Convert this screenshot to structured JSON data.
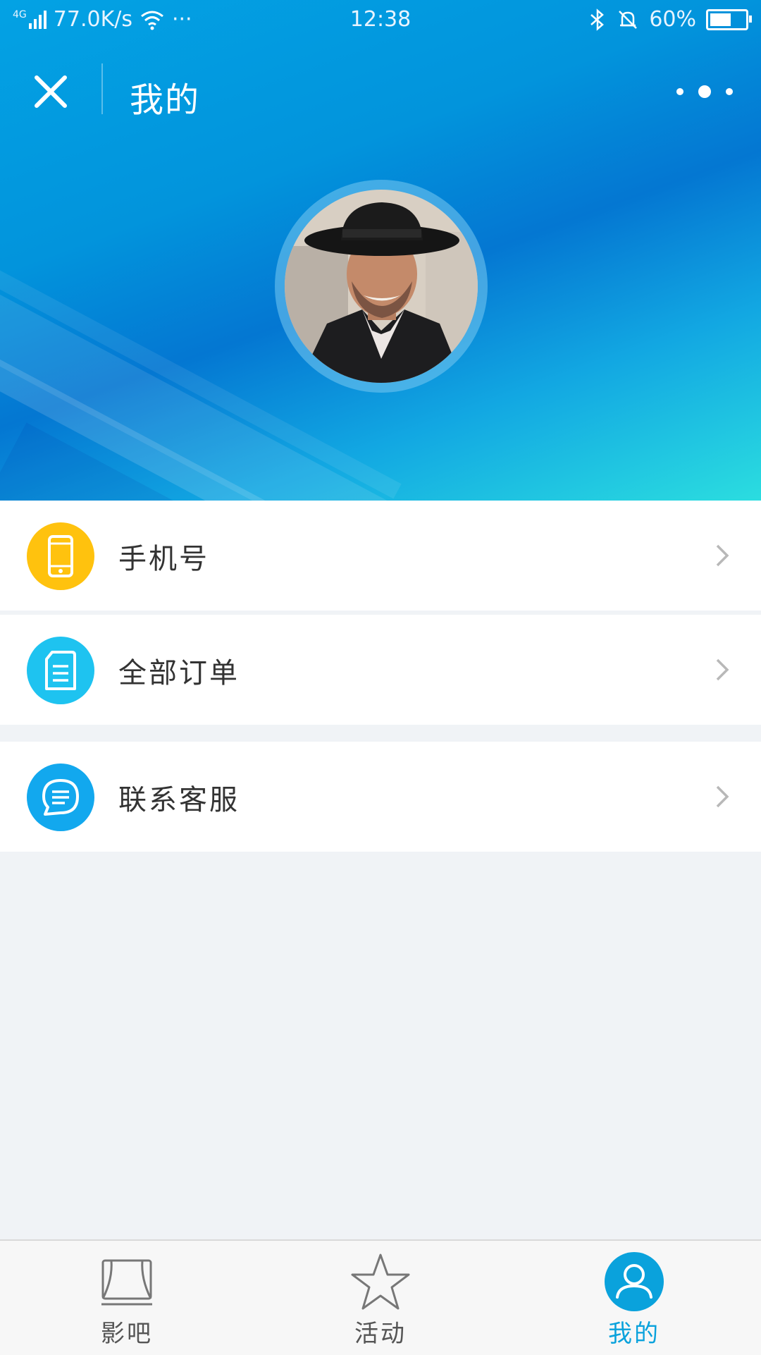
{
  "status_bar": {
    "network": "4G",
    "speed": "77.0K/s",
    "dots": "···",
    "time": "12:38",
    "battery_percent": "60%",
    "battery_level": 0.6
  },
  "nav": {
    "title": "我的"
  },
  "menu": [
    {
      "label": "手机号",
      "icon": "phone-icon",
      "color": "#ffc20e"
    },
    {
      "label": "全部订单",
      "icon": "orders-icon",
      "color": "#1ec3f0"
    },
    {
      "label": "联系客服",
      "icon": "customer-service-icon",
      "color": "#12a8ee"
    }
  ],
  "tabs": [
    {
      "label": "影吧",
      "icon": "cinema-icon",
      "active": false
    },
    {
      "label": "活动",
      "icon": "star-icon",
      "active": false
    },
    {
      "label": "我的",
      "icon": "user-icon",
      "active": true
    }
  ],
  "colors": {
    "accent": "#0aa2dc",
    "header_blue": "#0294dc",
    "background": "#f0f3f6"
  }
}
